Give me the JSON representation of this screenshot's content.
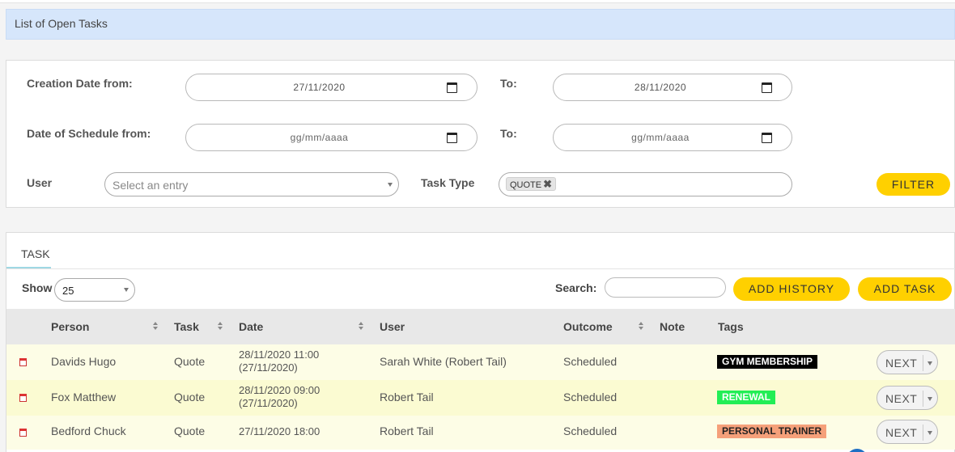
{
  "header": {
    "title": "List of Open Tasks"
  },
  "filters": {
    "creation_from_label": "Creation Date from:",
    "creation_from_value": "27/11/2020",
    "creation_to_label": "To:",
    "creation_to_value": "28/11/2020",
    "schedule_from_label": "Date of Schedule from:",
    "schedule_from_value": "gg/mm/aaaa",
    "schedule_to_label": "To:",
    "schedule_to_value": "gg/mm/aaaa",
    "user_label": "User",
    "user_placeholder": "Select an entry",
    "task_type_label": "Task Type",
    "task_type_selected": "QUOTE",
    "filter_button": "FILTER"
  },
  "tasks_panel": {
    "tab": "TASK",
    "show_label": "Show",
    "show_value": "25",
    "search_label": "Search:",
    "search_value": "",
    "add_history_button": "ADD HISTORY",
    "add_task_button": "ADD TASK",
    "columns": [
      "Person",
      "Task",
      "Date",
      "User",
      "Outcome",
      "Note",
      "Tags"
    ],
    "rows": [
      {
        "person": "Davids Hugo",
        "task": "Quote",
        "date": "28/11/2020 11:00",
        "date_sub": "(27/11/2020)",
        "user": "Sarah White (Robert Tail)",
        "outcome": "Scheduled",
        "note": "",
        "tag": "GYM MEMBERSHIP",
        "tag_bg": "#000000",
        "tag_fg": "#ffffff",
        "action": "NEXT"
      },
      {
        "person": "Fox Matthew",
        "task": "Quote",
        "date": "28/11/2020 09:00",
        "date_sub": "(27/11/2020)",
        "user": "Robert Tail",
        "outcome": "Scheduled",
        "note": "",
        "tag": "RENEWAL",
        "tag_bg": "#22ee55",
        "tag_fg": "#ffffff",
        "action": "NEXT"
      },
      {
        "person": "Bedford Chuck",
        "task": "Quote",
        "date": "27/11/2020 18:00",
        "date_sub": "",
        "user": "Robert Tail",
        "outcome": "Scheduled",
        "note": "",
        "tag": "PERSONAL TRAINER",
        "tag_bg": "#f5a07a",
        "tag_fg": "#222222",
        "action": "NEXT"
      }
    ]
  },
  "colors": {
    "accent": "#ffd000",
    "title_bar": "#d6e6fb"
  }
}
